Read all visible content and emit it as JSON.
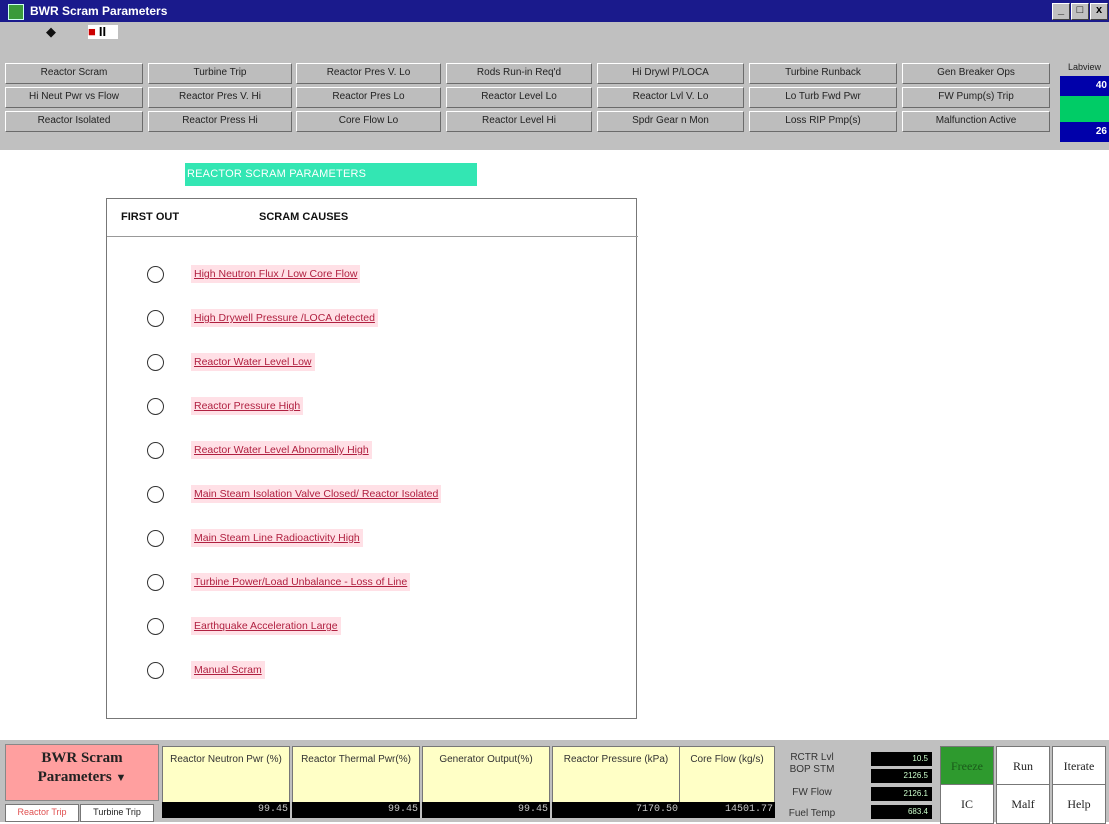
{
  "window": {
    "title": "BWR Scram Parameters",
    "minimize": "_",
    "maximize": "□",
    "close": "x"
  },
  "toolbar": {
    "play_icon": "◆",
    "record_pause_icon": "■"
  },
  "nav": {
    "row1": [
      "Reactor Scram",
      "Turbine Trip",
      "Reactor Pres V. Lo",
      "Rods Run-in Req'd",
      "Hi Drywl P/LOCA",
      "Turbine Runback",
      "Gen Breaker Ops"
    ],
    "row2": [
      "Hi Neut Pwr vs Flow",
      "Reactor Pres V. Hi",
      "Reactor Pres Lo",
      "Reactor Level Lo",
      "Reactor Lvl V. Lo",
      "Lo Turb Fwd Pwr",
      "FW Pump(s) Trip"
    ],
    "row3": [
      "Reactor Isolated",
      "Reactor Press Hi",
      "Core Flow Lo",
      "Reactor Level Hi",
      "Spdr Gear n Mon",
      "Loss RIP Pmp(s)",
      "Malfunction Active"
    ],
    "side_label": "Labview",
    "side_value1": "40",
    "side_value2": "26"
  },
  "main": {
    "header": "REACTOR SCRAM PARAMETERS",
    "col_first_out": "FIRST OUT",
    "col_scram_causes": "SCRAM CAUSES",
    "causes": [
      "High Neutron Flux / Low Core Flow",
      "High Drywell Pressure /LOCA detected",
      "Reactor Water Level Low",
      "Reactor Pressure High",
      "Reactor Water Level Abnormally High",
      "Main Steam Isolation Valve Closed/ Reactor Isolated",
      "Main Steam Line Radioactivity High",
      "Turbine Power/Load Unbalance - Loss of Line",
      "Earthquake Acceleration Large",
      "Manual Scram"
    ]
  },
  "bottom": {
    "display_name_line1": "BWR Scram",
    "display_name_line2": "Parameters",
    "tab_reactor_trip": "Reactor Trip",
    "tab_turbine_trip": "Turbine Trip",
    "gauges": [
      {
        "label": "Reactor Neutron Pwr (%)",
        "value": "99.45"
      },
      {
        "label": "Reactor Thermal Pwr(%)",
        "value": "99.45"
      },
      {
        "label": "Generator Output(%)",
        "value": "99.45"
      },
      {
        "label": "Reactor Pressure (kPa)",
        "value": "7170.50"
      },
      {
        "label": "Core Flow (kg/s)",
        "value": "14501.77"
      }
    ],
    "rctr_lvl_label": "RCTR Lvl",
    "bop_stm_label": "BOP STM",
    "fw_flow_label": "FW Flow",
    "fuel_temp_label": "Fuel Temp",
    "rctr_lvl_value": "10.5",
    "bop_stm_value": "2126.5",
    "fw_flow_value": "2126.1",
    "fuel_temp_value": "683.4",
    "buttons": {
      "freeze": "Freeze",
      "run": "Run",
      "iterate": "Iterate",
      "ic": "IC",
      "malf": "Malf",
      "help": "Help"
    }
  }
}
